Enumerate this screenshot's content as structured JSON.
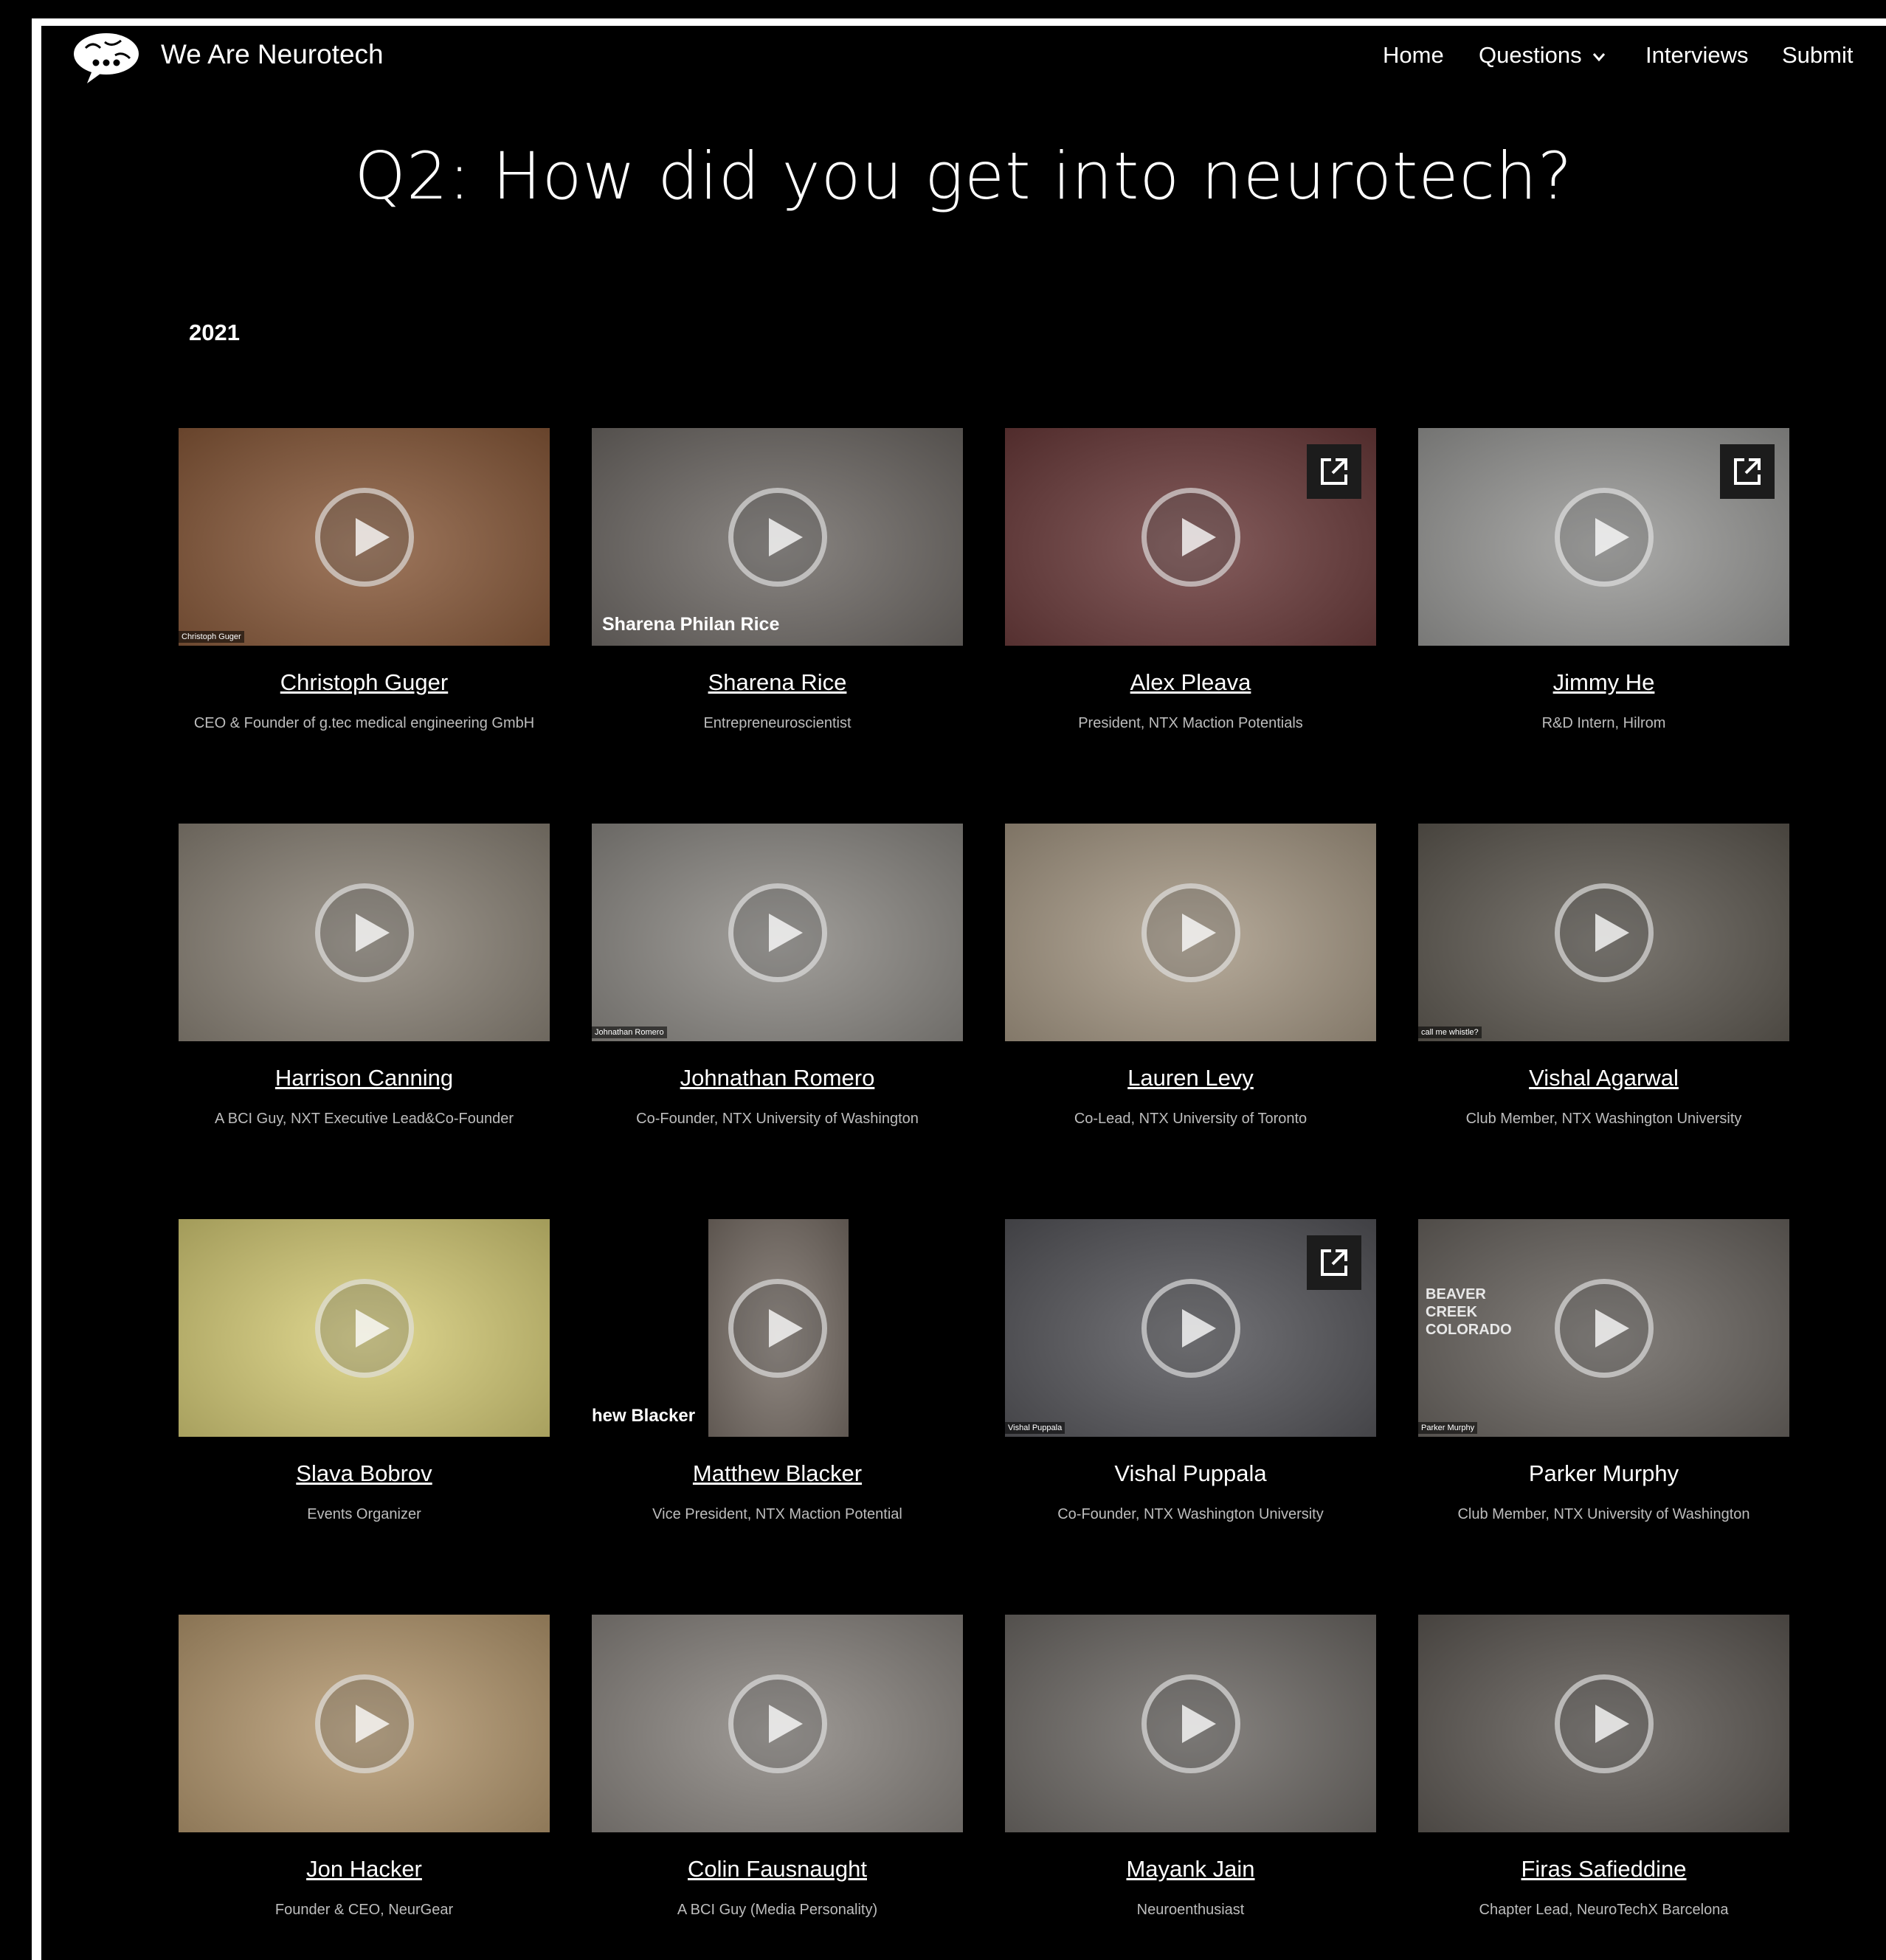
{
  "nav": {
    "brand": "We Are Neurotech",
    "links": {
      "home": "Home",
      "questions": "Questions",
      "interviews": "Interviews",
      "submit": "Submit"
    }
  },
  "page": {
    "title": "Q2: How did you get into neurotech?",
    "year": "2021"
  },
  "cards": [
    {
      "name": "Christoph Guger",
      "role": "CEO & Founder of g.tec medical engineering GmbH",
      "bg": "#8a5a3a",
      "tag": "Christoph Guger"
    },
    {
      "name": "Sharena Rice",
      "role": "Entrepreneuroscientist",
      "bg": "#6f6a66",
      "overlay": "Sharena Philan Rice"
    },
    {
      "name": "Alex Pleava",
      "role": "President, NTX Maction Potentials",
      "bg": "#6b3a3a"
    },
    {
      "name": "Jimmy He",
      "role": "R&D Intern, Hilrom",
      "bg": "#9a9a98"
    },
    {
      "name": "Harrison Canning",
      "role": "A BCI Guy, NXT Executive Lead&Co-Founder",
      "bg": "#8c8478"
    },
    {
      "name": "Johnathan Romero",
      "role": "Co-Founder, NTX University of Washington",
      "bg": "#8d8a85",
      "tag": "Johnathan Romero"
    },
    {
      "name": "Lauren Levy",
      "role": "Co-Lead, NTX University of Toronto",
      "bg": "#a89a86"
    },
    {
      "name": "Vishal Agarwal",
      "role": "Club Member, NTX Washington University",
      "bg": "#5f5a52",
      "tag": "call me whistle?"
    },
    {
      "name": "Slava Bobrov",
      "role": "Events Organizer",
      "bg": "#d9cf78"
    },
    {
      "name": "Matthew Blacker",
      "role": "Vice President, NTX Maction Potential",
      "bg": "#7a7068",
      "overlay": "hew Blacker"
    },
    {
      "name": "Vishal Puppala",
      "role": "Co-Founder, NTX Washington University",
      "bg": "#55555a",
      "tag": "Vishal Puppala"
    },
    {
      "name": "Parker Murphy",
      "role": "Club Member, NTX University of Washington",
      "bg": "#6a6560",
      "tag": "Parker Murphy",
      "overlay2": "BEAVER CREEK COLORADO"
    },
    {
      "name": "Jon Hacker",
      "role": "Founder & CEO, NeurGear",
      "bg": "#b79a70"
    },
    {
      "name": "Colin Fausnaught",
      "role": "A BCI Guy (Media Personality)",
      "bg": "#8a8580"
    },
    {
      "name": "Mayank Jain",
      "role": "Neuroenthusiast",
      "bg": "#6e6a66"
    },
    {
      "name": "Firas Safieddine",
      "role": "Chapter Lead, NeuroTechX Barcelona",
      "bg": "#5e5954"
    }
  ]
}
